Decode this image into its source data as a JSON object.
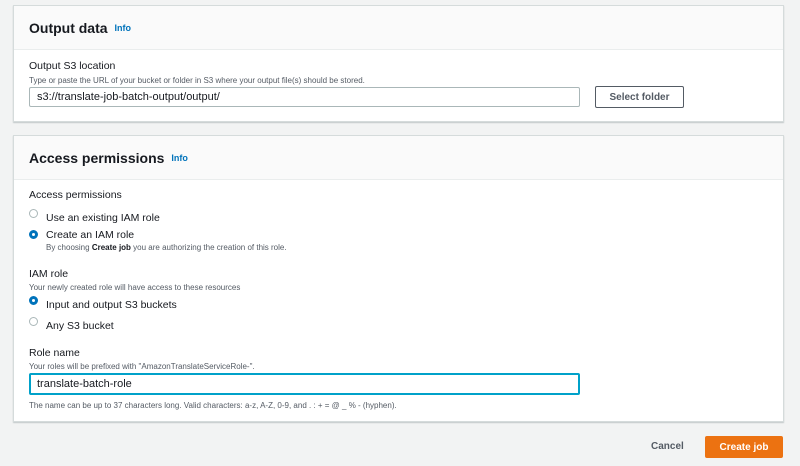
{
  "output_panel": {
    "title": "Output data",
    "info": "Info",
    "s3_label": "Output S3 location",
    "s3_description": "Type or paste the URL of your bucket or folder in S3 where your output file(s) should be stored.",
    "s3_value": "s3://translate-job-batch-output/output/",
    "select_folder": "Select folder"
  },
  "access_panel": {
    "title": "Access permissions",
    "info": "Info",
    "permissions_label": "Access permissions",
    "options": [
      {
        "label": "Use an existing IAM role",
        "checked": false
      },
      {
        "label": "Create an IAM role",
        "checked": true,
        "desc_prefix": "By choosing ",
        "desc_bold": "Create job",
        "desc_suffix": " you are authorizing the creation of this role."
      }
    ],
    "iam_role_label": "IAM role",
    "iam_role_description": "Your newly created role will have access to these resources",
    "iam_options": [
      {
        "label": "Input and output S3 buckets",
        "checked": true
      },
      {
        "label": "Any S3 bucket",
        "checked": false
      }
    ],
    "role_name_label": "Role name",
    "role_name_description": "Your roles will be prefixed with \"AmazonTranslateServiceRole-\".",
    "role_name_value": "translate-batch-role",
    "role_name_constraint": "The name can be up to 37 characters long. Valid characters: a-z, A-Z, 0-9, and . : + = @ _ % - (hyphen)."
  },
  "footer": {
    "cancel": "Cancel",
    "create": "Create job"
  },
  "colors": {
    "accent": "#0073bb",
    "primary_button": "#ec7211",
    "focus": "#00a1c9"
  }
}
